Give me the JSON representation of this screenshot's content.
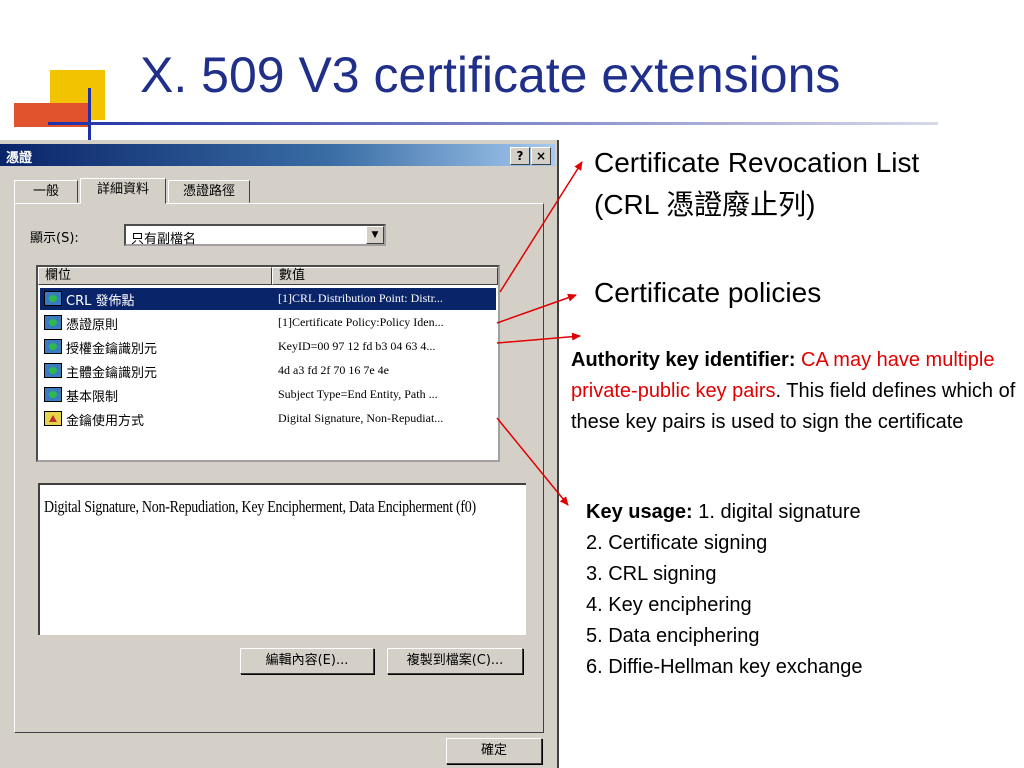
{
  "slide": {
    "title": "X. 509 V3 certificate extensions"
  },
  "dialog": {
    "title": "憑證",
    "help_button": "?",
    "close_button": "×",
    "tabs": [
      {
        "label": "一般"
      },
      {
        "label": "詳細資料"
      },
      {
        "label": "憑證路徑"
      }
    ],
    "show_label": "顯示(S):",
    "show_value": "只有副檔名",
    "columns": [
      "欄位",
      "數值"
    ],
    "rows": [
      {
        "field": "CRL 發佈點",
        "value": "[1]CRL Distribution Point: Distr...",
        "icon": "certificate-extension-icon"
      },
      {
        "field": "憑證原則",
        "value": "[1]Certificate Policy:Policy Iden...",
        "icon": "certificate-extension-icon"
      },
      {
        "field": "授權金鑰識別元",
        "value": "KeyID=00 97 12 fd b3 04 63 4...",
        "icon": "certificate-extension-icon"
      },
      {
        "field": "主體金鑰識別元",
        "value": "4d a3 fd 2f 70 16 7e 4e",
        "icon": "certificate-extension-icon"
      },
      {
        "field": "基本限制",
        "value": "Subject Type=End Entity, Path ...",
        "icon": "certificate-extension-icon"
      },
      {
        "field": "金鑰使用方式",
        "value": "Digital Signature, Non-Repudiat...",
        "icon": "critical-extension-warning-icon"
      }
    ],
    "detail_text": "Digital Signature, Non-Repudiation, Key Encipherment, Data Encipherment (f0)",
    "edit_button": "編輯內容(E)...",
    "copy_button": "複製到檔案(C)...",
    "ok_button": "確定"
  },
  "annotations": {
    "crl_line1": "Certificate Revocation List",
    "crl_line2": "(CRL 憑證廢止列)",
    "policies": "Certificate policies",
    "aki_label": "Authority key identifier:",
    "aki_red": "CA may have multiple private-public key pairs",
    "aki_rest": ". This field defines which of these key pairs is used to sign the certificate",
    "ku_label": "Key usage:",
    "ku_item1": "1. digital signature",
    "ku_items": [
      "2. Certificate signing",
      "3. CRL signing",
      "4. Key enciphering",
      "5. Data enciphering",
      "6. Diffie-Hellman key exchange"
    ]
  },
  "colors": {
    "title": "#1f2f8a",
    "arrow": "#e00000",
    "highlight": "#e00000",
    "selection": "#0a246a"
  }
}
